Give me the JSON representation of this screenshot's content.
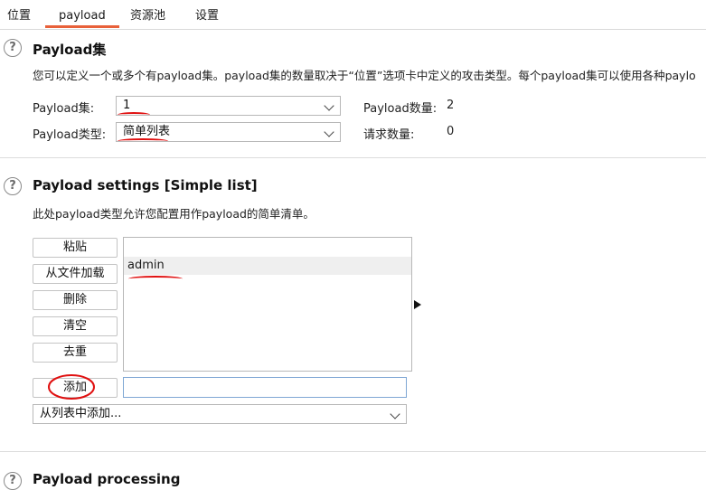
{
  "tabs": [
    {
      "label": "位置"
    },
    {
      "label": "payload"
    },
    {
      "label": "资源池"
    },
    {
      "label": "设置"
    }
  ],
  "payload_sets": {
    "title": "Payload集",
    "description": "您可以定义一个或多个有payload集。payload集的数量取决于“位置”选项卡中定义的攻击类型。每个payload集可以使用各种paylo",
    "set_label": "Payload集:",
    "set_value": "1",
    "type_label": "Payload类型:",
    "type_value": "简单列表",
    "count_label": "Payload数量:",
    "count_value": "2",
    "request_label": "请求数量:",
    "request_value": "0"
  },
  "payload_settings": {
    "title": "Payload settings [Simple list]",
    "description": "此处payload类型允许您配置用作payload的简单清单。",
    "buttons": {
      "paste": "粘贴",
      "load": "从文件加载",
      "remove": "删除",
      "clear": "清空",
      "dedupe": "去重",
      "add": "添加"
    },
    "items": [
      "admin"
    ],
    "add_input_value": "",
    "add_from_list": "从列表中添加..."
  },
  "payload_processing": {
    "title": "Payload processing"
  },
  "colors": {
    "accent": "#e8613a",
    "annotation": "#e01010"
  }
}
